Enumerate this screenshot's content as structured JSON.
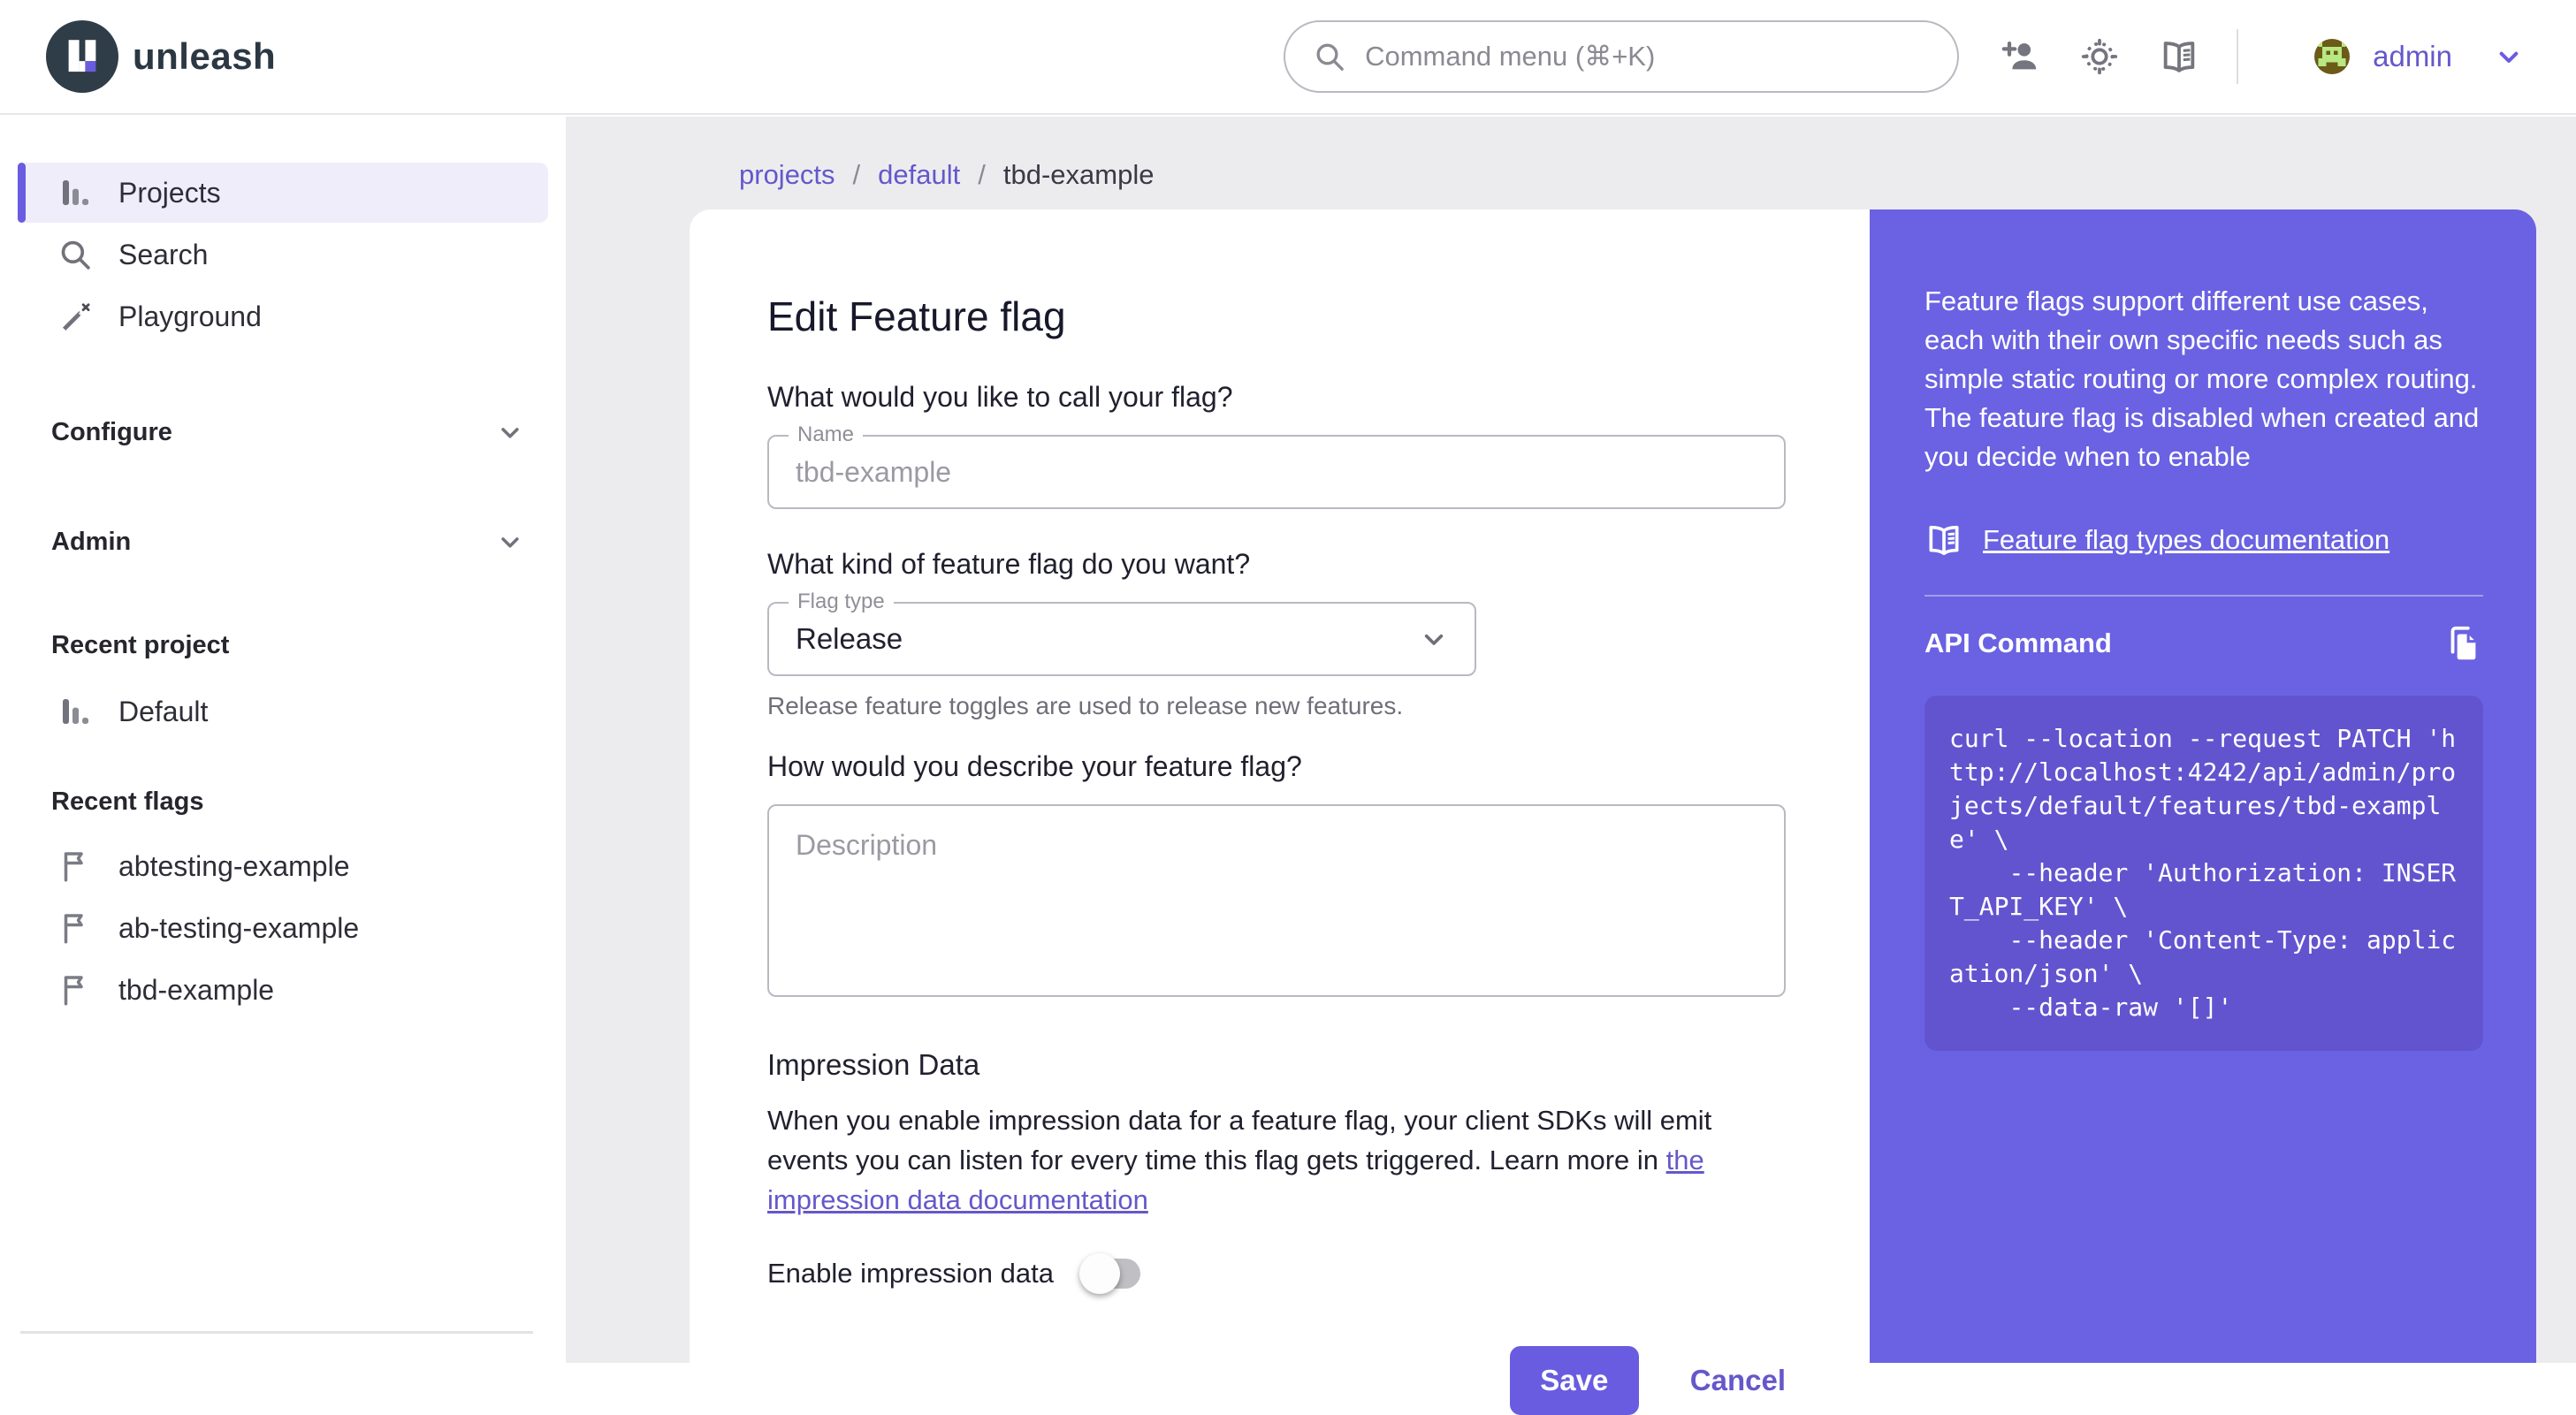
{
  "header": {
    "brand": "unleash",
    "search_placeholder": "Command menu (⌘+K)",
    "username": "admin"
  },
  "sidebar": {
    "nav": [
      {
        "label": "Projects"
      },
      {
        "label": "Search"
      },
      {
        "label": "Playground"
      }
    ],
    "sections": {
      "configure": "Configure",
      "admin": "Admin"
    },
    "recent_project": {
      "header": "Recent project",
      "item": "Default"
    },
    "recent_flags": {
      "header": "Recent flags",
      "items": [
        "abtesting-example",
        "ab-testing-example",
        "tbd-example"
      ]
    }
  },
  "breadcrumb": {
    "items": [
      "projects",
      "default",
      "tbd-example"
    ],
    "separator": "/"
  },
  "form": {
    "title": "Edit Feature flag",
    "name_question": "What would you like to call your flag?",
    "name_label": "Name",
    "name_placeholder": "tbd-example",
    "type_question": "What kind of feature flag do you want?",
    "type_label": "Flag type",
    "type_value": "Release",
    "type_helper": "Release feature toggles are used to release new features.",
    "desc_question": "How would you describe your feature flag?",
    "desc_placeholder": "Description",
    "impression_title": "Impression Data",
    "impression_text": "When you enable impression data for a feature flag, your client SDKs will emit events you can listen for every time this flag gets triggered. Learn more in ",
    "impression_link": "the impression data documentation",
    "toggle_label": "Enable impression data",
    "toggle_state": "off",
    "save_label": "Save",
    "cancel_label": "Cancel"
  },
  "guide": {
    "intro": "Feature flags support different use cases, each with their own specific needs such as simple static routing or more complex routing. The feature flag is disabled when created and you decide when to enable",
    "docs_link": "Feature flag types documentation",
    "api_title": "API Command",
    "curl_command": "curl --location --request PATCH 'http://localhost:4242/api/admin/projects/default/features/tbd-example' \\\n    --header 'Authorization: INSERT_API_KEY' \\\n    --header 'Content-Type: application/json' \\\n    --data-raw '[]'"
  },
  "icons": [
    "unleash-logo-icon",
    "search-icon",
    "add-user-icon",
    "theme-sun-icon",
    "docs-book-icon",
    "chevron-down-icon",
    "projects-chart-icon",
    "playground-wand-icon",
    "flag-icon",
    "copy-icon"
  ],
  "colors": {
    "accent": "#6a5ce0",
    "panel": "#6a62e2",
    "code_bg": "#6254cf",
    "active_nav_bg": "#efedfa",
    "content_bg": "#ececef"
  }
}
